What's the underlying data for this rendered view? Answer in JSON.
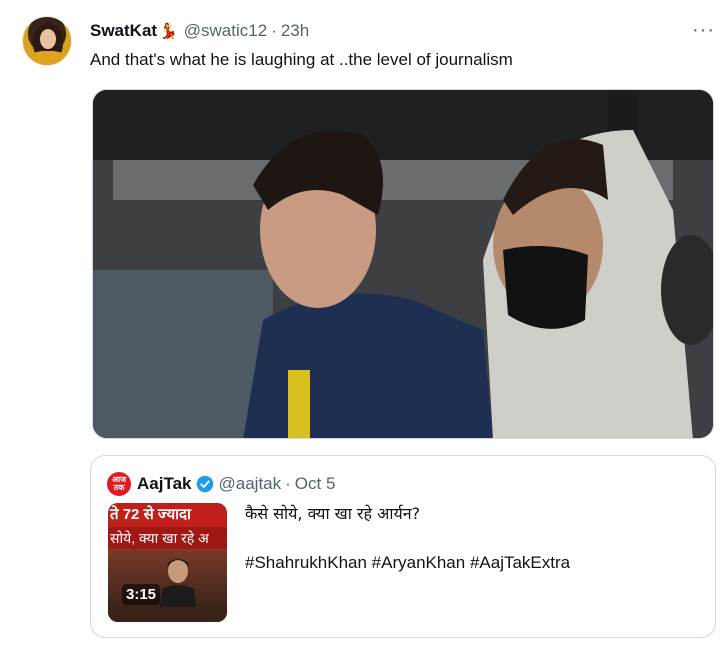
{
  "tweet": {
    "display_name": "SwatKat",
    "name_emoji": "💃",
    "handle": "@swatic12",
    "separator": "·",
    "time": "23h",
    "more_label": "···",
    "text": "And that's what he is laughing at ..the level of journalism"
  },
  "quoted_tweet": {
    "avatar_text": "आज तक",
    "display_name": "AajTak",
    "handle": "@aajtak",
    "separator": "·",
    "date": "Oct 5",
    "text_line1": "कैसे सोये, क्या खा रहे आर्यन?",
    "text_line2": "#ShahrukhKhan #AryanKhan #AajTakExtra",
    "thumbnail": {
      "banner_line1": "ते 72 से ज्यादा",
      "banner_line2": "सोये, क्या खा रहे अ",
      "duration": "3:15"
    }
  },
  "colors": {
    "verified_blue": "#1d9bf0",
    "secondary_text": "#536471",
    "border": "#cfd9de",
    "aajtak_red": "#e21b22"
  }
}
